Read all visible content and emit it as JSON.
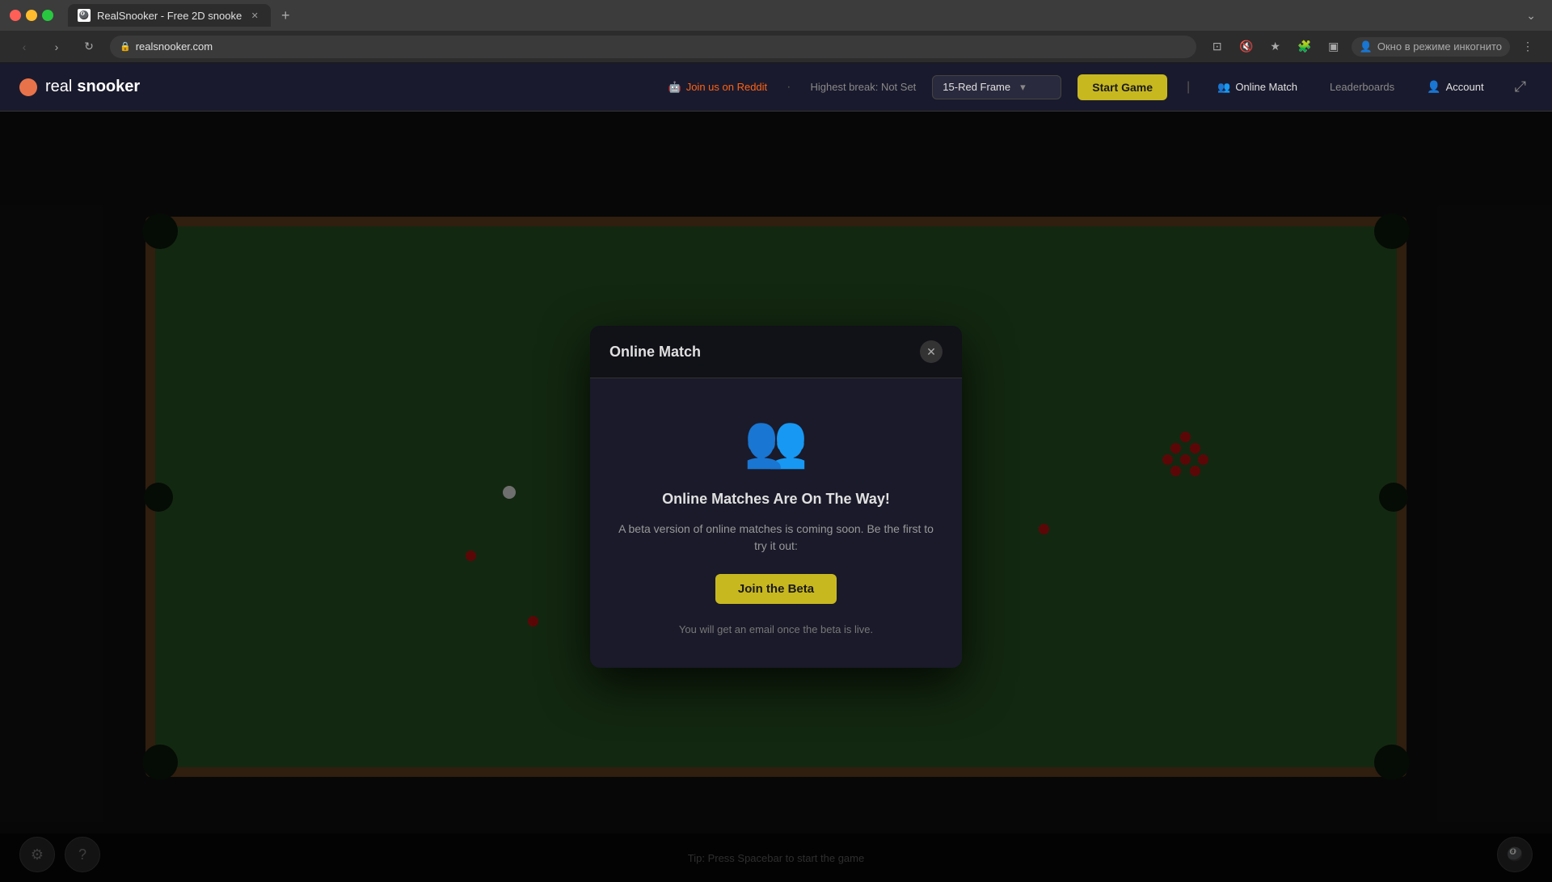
{
  "browser": {
    "tab_title": "RealSnooker - Free 2D snooke",
    "url": "realsnooker.com",
    "incognito_label": "Окно в режиме инкогнито"
  },
  "header": {
    "logo_real": "real",
    "logo_snooker": "snooker",
    "reddit_label": "Join us on Reddit",
    "separator": "·",
    "highest_break_label": "Highest break:",
    "highest_break_value": "Not Set",
    "frame_selector_value": "15-Red Frame",
    "start_game_label": "Start Game",
    "online_match_label": "Online Match",
    "leaderboards_label": "Leaderboards",
    "account_label": "Account"
  },
  "modal": {
    "title": "Online Match",
    "icon": "👥",
    "heading": "Online Matches Are On The Way!",
    "subtext": "A beta version of online matches is coming soon. Be the first to try it out:",
    "join_beta_label": "Join the Beta",
    "footnote": "You will get an email once the beta is live."
  },
  "bottom": {
    "tip_text": "Tip: Press Spacebar to start the game"
  }
}
